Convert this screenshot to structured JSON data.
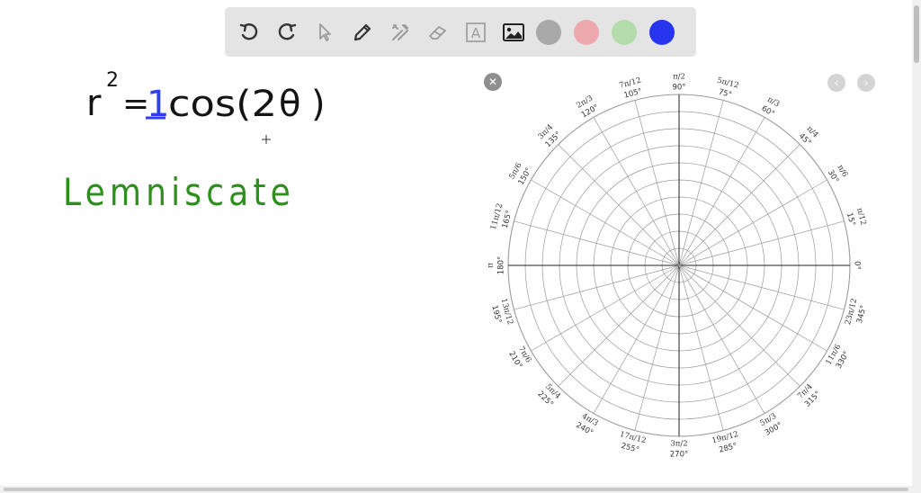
{
  "toolbar": {
    "tools": [
      {
        "name": "undo-icon"
      },
      {
        "name": "redo-icon"
      },
      {
        "name": "pointer-icon"
      },
      {
        "name": "pen-icon"
      },
      {
        "name": "tools-icon"
      },
      {
        "name": "eraser-icon"
      },
      {
        "name": "text-icon",
        "label": "A"
      },
      {
        "name": "image-icon"
      }
    ],
    "colors": [
      "#a8a8a8",
      "#eca8ac",
      "#b4dcaa",
      "#2735ee"
    ],
    "selected_color": "#2735ee"
  },
  "canvas": {
    "equation": {
      "r": "r",
      "exponent": "2",
      "equals": "=",
      "coefficient": "1",
      "rest": "cos(2",
      "theta": "θ",
      "close": ")"
    },
    "label": "Lemniscate",
    "colors": {
      "ink": "#141414",
      "blue": "#2f3ff0",
      "green": "#2f8f1e"
    }
  },
  "polar_grid": {
    "rings": 10,
    "spoke_step_degrees": 15,
    "labels": [
      {
        "deg": "0°",
        "rad": ""
      },
      {
        "deg": "15°",
        "rad": "π/12"
      },
      {
        "deg": "30°",
        "rad": "π/6"
      },
      {
        "deg": "45°",
        "rad": "π/4"
      },
      {
        "deg": "60°",
        "rad": "π/3"
      },
      {
        "deg": "75°",
        "rad": "5π/12"
      },
      {
        "deg": "90°",
        "rad": "π/2"
      },
      {
        "deg": "105°",
        "rad": "7π/12"
      },
      {
        "deg": "120°",
        "rad": "2π/3"
      },
      {
        "deg": "135°",
        "rad": "3π/4"
      },
      {
        "deg": "150°",
        "rad": "5π/6"
      },
      {
        "deg": "165°",
        "rad": "11π/12"
      },
      {
        "deg": "180°",
        "rad": "π"
      },
      {
        "deg": "195°",
        "rad": "13π/12"
      },
      {
        "deg": "210°",
        "rad": "7π/6"
      },
      {
        "deg": "225°",
        "rad": "5π/4"
      },
      {
        "deg": "240°",
        "rad": "4π/3"
      },
      {
        "deg": "255°",
        "rad": "17π/12"
      },
      {
        "deg": "270°",
        "rad": "3π/2"
      },
      {
        "deg": "285°",
        "rad": "19π/12"
      },
      {
        "deg": "300°",
        "rad": "5π/3"
      },
      {
        "deg": "315°",
        "rad": "7π/4"
      },
      {
        "deg": "330°",
        "rad": "11π/6"
      },
      {
        "deg": "345°",
        "rad": "23π/12"
      }
    ]
  }
}
